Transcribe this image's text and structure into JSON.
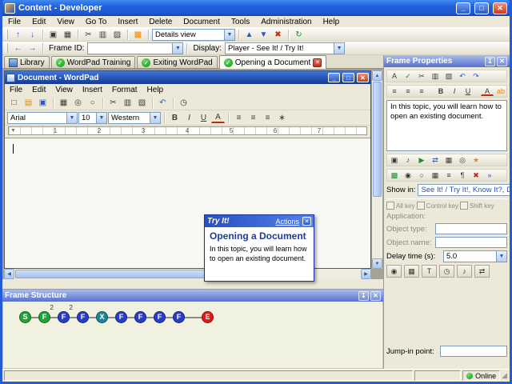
{
  "window": {
    "title": "Content - Developer",
    "min": "_",
    "max": "□",
    "close": "✕"
  },
  "menubar": {
    "items": [
      "File",
      "Edit",
      "View",
      "Go To",
      "Insert",
      "Delete",
      "Document",
      "Tools",
      "Administration",
      "Help"
    ]
  },
  "toolbar1": {
    "icons_left": [
      {
        "name": "up-arrow-icon",
        "glyph": "↑"
      },
      {
        "name": "down-arrow-icon",
        "glyph": "↓"
      },
      {
        "name": "save-icon",
        "glyph": "▣"
      },
      {
        "name": "print-icon",
        "glyph": "▦"
      },
      {
        "name": "cut-icon",
        "glyph": "✂"
      },
      {
        "name": "copy-icon",
        "glyph": "▥"
      },
      {
        "name": "paste-icon",
        "glyph": "▨"
      },
      {
        "name": "highlight-icon",
        "glyph": "▩"
      }
    ],
    "details_view": "Details view",
    "icons_mid": [
      {
        "name": "move-up-icon",
        "glyph": "▲"
      },
      {
        "name": "move-down-icon",
        "glyph": "▼"
      },
      {
        "name": "delete-icon",
        "glyph": "✖"
      },
      {
        "name": "refresh-icon",
        "glyph": "↻"
      }
    ]
  },
  "toolbar2": {
    "icons_left": [
      {
        "name": "back-icon",
        "glyph": "←"
      },
      {
        "name": "forward-icon",
        "glyph": "→"
      }
    ],
    "frame_id_label": "Frame ID:",
    "display_label": "Display:",
    "display_value": "Player - See It! / Try It!"
  },
  "tabs": {
    "items": [
      {
        "label": "Library"
      },
      {
        "label": "WordPad Training"
      },
      {
        "label": "Exiting WordPad"
      },
      {
        "label": "Opening a Document"
      }
    ]
  },
  "wordpad": {
    "title": "Document - WordPad",
    "min": "_",
    "max": "□",
    "close": "✕",
    "menu": [
      "File",
      "Edit",
      "View",
      "Insert",
      "Format",
      "Help"
    ],
    "toolbar": [
      {
        "name": "new-icon",
        "glyph": "□"
      },
      {
        "name": "open-icon",
        "glyph": "▤"
      },
      {
        "name": "save-icon",
        "glyph": "▣"
      },
      {
        "name": "print-icon",
        "glyph": "▦"
      },
      {
        "name": "print-preview-icon",
        "glyph": "◎"
      },
      {
        "name": "find-icon",
        "glyph": "○"
      },
      {
        "name": "cut-icon",
        "glyph": "✂"
      },
      {
        "name": "copy-icon",
        "glyph": "▥"
      },
      {
        "name": "paste-icon",
        "glyph": "▨"
      },
      {
        "name": "undo-icon",
        "glyph": "↶"
      },
      {
        "name": "datetime-icon",
        "glyph": "◷"
      }
    ],
    "font_name": "Arial",
    "font_size": "10",
    "font_script": "Western",
    "bold": "B",
    "italic": "I",
    "underline": "U",
    "font_color": "A",
    "format_icons": [
      {
        "name": "align-left-icon",
        "glyph": "≡"
      },
      {
        "name": "align-center-icon",
        "glyph": "≡"
      },
      {
        "name": "align-right-icon",
        "glyph": "≡"
      },
      {
        "name": "bullets-icon",
        "glyph": "∗"
      }
    ],
    "ruler": [
      "1",
      "2",
      "3",
      "4",
      "5",
      "6",
      "7"
    ]
  },
  "tryit": {
    "title": "Try It!",
    "actions": "Actions",
    "close": "✕",
    "heading": "Opening a Document",
    "body": "In this topic, you will learn how to open an existing document."
  },
  "frame_properties": {
    "title": "Frame Properties",
    "pin": "↧",
    "close": "✕",
    "toolbar_row1": [
      {
        "name": "fp-font-icon",
        "glyph": "A"
      },
      {
        "name": "fp-spelling-icon",
        "glyph": "✓"
      },
      {
        "name": "fp-cut-icon",
        "glyph": "✂"
      },
      {
        "name": "fp-copy-icon",
        "glyph": "▥"
      },
      {
        "name": "fp-paste-icon",
        "glyph": "▨"
      },
      {
        "name": "fp-undo-icon",
        "glyph": "↶"
      },
      {
        "name": "fp-redo-icon",
        "glyph": "↷"
      }
    ],
    "toolbar_row2": [
      {
        "name": "align-left-icon",
        "glyph": "≡"
      },
      {
        "name": "align-center-icon",
        "glyph": "≡"
      },
      {
        "name": "align-right-icon",
        "glyph": "≡"
      },
      {
        "name": "bold-icon",
        "glyph": "B"
      },
      {
        "name": "italic-icon",
        "glyph": "I"
      },
      {
        "name": "underline-icon",
        "glyph": "U"
      },
      {
        "name": "font-color-icon",
        "glyph": "A"
      },
      {
        "name": "highlight-text-icon",
        "glyph": "ab"
      }
    ],
    "text": "In this topic, you will learn how to open an existing document.",
    "toolbar_row3": [
      {
        "name": "fp-image-icon",
        "glyph": "▣"
      },
      {
        "name": "fp-audio-icon",
        "glyph": "♪"
      },
      {
        "name": "fp-video-icon",
        "glyph": "▶"
      },
      {
        "name": "fp-link-icon",
        "glyph": "⇄"
      },
      {
        "name": "fp-table-icon",
        "glyph": "▦"
      },
      {
        "name": "fp-attach-icon",
        "glyph": "◎"
      },
      {
        "name": "fp-effect-icon",
        "glyph": "★"
      }
    ],
    "toolbar_row4": [
      {
        "name": "fp-marker-icon",
        "glyph": "▩"
      },
      {
        "name": "fp-eyedropper-icon",
        "glyph": "◉"
      },
      {
        "name": "fp-zoom-icon",
        "glyph": "○"
      },
      {
        "name": "fp-grid-icon",
        "glyph": "▦"
      },
      {
        "name": "fp-list-icon",
        "glyph": "≡"
      },
      {
        "name": "fp-style-icon",
        "glyph": "¶"
      },
      {
        "name": "fp-clear-icon",
        "glyph": "✖"
      },
      {
        "name": "fp-more-icon",
        "glyph": "»"
      }
    ],
    "show_in_label": "Show in:",
    "show_in_value": "See It! / Try It!, Know It?, Do It!",
    "keys": [
      "All key",
      "Control key",
      "Shift key"
    ],
    "application_label": "Application:",
    "object_type_label": "Object type:",
    "object_name_label": "Object name:",
    "delay_label": "Delay time (s):",
    "delay_value": "5.0",
    "action_icons": [
      {
        "name": "mouse-action-icon",
        "glyph": "◉"
      },
      {
        "name": "keyboard-action-icon",
        "glyph": "▦"
      },
      {
        "name": "text-action-icon",
        "glyph": "T"
      },
      {
        "name": "timer-action-icon",
        "glyph": "◷"
      },
      {
        "name": "audio-action-icon",
        "glyph": "♪"
      },
      {
        "name": "branch-action-icon",
        "glyph": "⇄"
      }
    ],
    "jump_in_label": "Jump-in point:"
  },
  "frame_structure": {
    "title": "Frame Structure",
    "pin": "↧",
    "close": "✕",
    "nodes": [
      {
        "label": "S",
        "color": "#22A33C"
      },
      {
        "label": "F",
        "color": "#22A33C",
        "badge": "2"
      },
      {
        "label": "F",
        "color": "#2A3DC8",
        "badge": "2"
      },
      {
        "label": "F",
        "color": "#2A3DC8"
      },
      {
        "label": "X",
        "color": "#17889B"
      },
      {
        "label": "F",
        "color": "#2A3DC8"
      },
      {
        "label": "F",
        "color": "#2A3DC8"
      },
      {
        "label": "F",
        "color": "#2A3DC8"
      },
      {
        "label": "F",
        "color": "#2A3DC8"
      },
      {
        "label": "E",
        "color": "#DE1A1A"
      }
    ]
  },
  "statusbar": {
    "online_label": "Online"
  },
  "colors": {
    "titlebar_blue": "#2360DC",
    "panel_header_top": "#A9BDEC",
    "panel_header_bottom": "#5870CC",
    "xp_tan": "#ECE9D8",
    "node_green": "#22A33C",
    "node_blue": "#2A3DC8",
    "node_teal": "#17889B",
    "node_red": "#DE1A1A"
  }
}
